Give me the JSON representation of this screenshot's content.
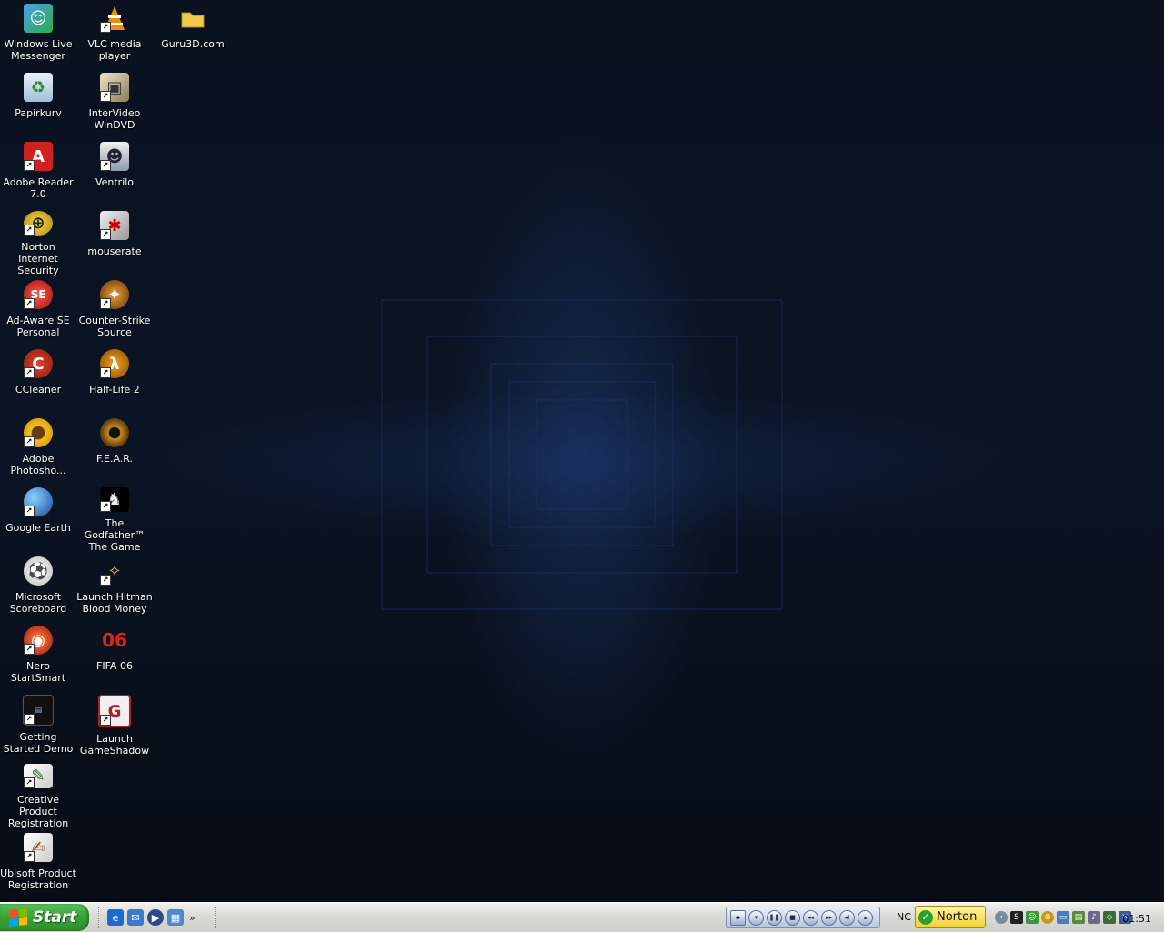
{
  "desktop": {
    "icons": [
      {
        "label": "Windows Live Messenger",
        "icon": "messenger-icon"
      },
      {
        "label": "VLC media player",
        "icon": "vlc-cone-icon"
      },
      {
        "label": "Guru3D.com",
        "icon": "folder-icon"
      },
      {
        "label": "Papirkurv",
        "icon": "recycle-bin-icon"
      },
      {
        "label": "InterVideo WinDVD",
        "icon": "windvd-icon"
      },
      {
        "label": "Adobe Reader 7.0",
        "icon": "adobe-reader-icon"
      },
      {
        "label": "Ventrilo",
        "icon": "ventrilo-icon"
      },
      {
        "label": "Norton Internet Security",
        "icon": "norton-globe-icon"
      },
      {
        "label": "mouserate",
        "icon": "mouserate-icon"
      },
      {
        "label": "Ad-Aware SE Personal",
        "icon": "ad-aware-icon"
      },
      {
        "label": "Counter-Strike Source",
        "icon": "counter-strike-icon"
      },
      {
        "label": "CCleaner",
        "icon": "ccleaner-icon"
      },
      {
        "label": "Half-Life 2",
        "icon": "half-life-icon"
      },
      {
        "label": "Adobe Photosho...",
        "icon": "photoshop-sunflower-icon"
      },
      {
        "label": "F.E.A.R.",
        "icon": "fear-eye-icon"
      },
      {
        "label": "Google Earth",
        "icon": "google-earth-icon"
      },
      {
        "label": "The Godfather™ The Game",
        "icon": "godfather-icon"
      },
      {
        "label": "Microsoft Scoreboard",
        "icon": "soccer-ball-icon"
      },
      {
        "label": "Launch Hitman Blood Money",
        "icon": "hitman-icon"
      },
      {
        "label": "Nero StartSmart",
        "icon": "nero-icon"
      },
      {
        "label": "FIFA 06",
        "icon": "fifa-06-icon"
      },
      {
        "label": "Getting Started Demo",
        "icon": "audigy-demo-icon"
      },
      {
        "label": "Launch GameShadow",
        "icon": "gameshadow-icon"
      },
      {
        "label": "Creative Product Registration",
        "icon": "registration-icon"
      },
      {
        "label": "Ubisoft Product Registration",
        "icon": "registration-pen-icon"
      }
    ]
  },
  "taskbar": {
    "start_label": "Start",
    "quick_launch": [
      "internet-explorer-icon",
      "outlook-express-icon",
      "media-player-icon",
      "show-desktop-icon"
    ],
    "quick_launch_more": "»",
    "tray_text": "NC",
    "norton_label": "Norton",
    "clock": "01:51",
    "accent_start_green": "#3aa33a",
    "accent_norton_yellow": "#f2d030"
  }
}
